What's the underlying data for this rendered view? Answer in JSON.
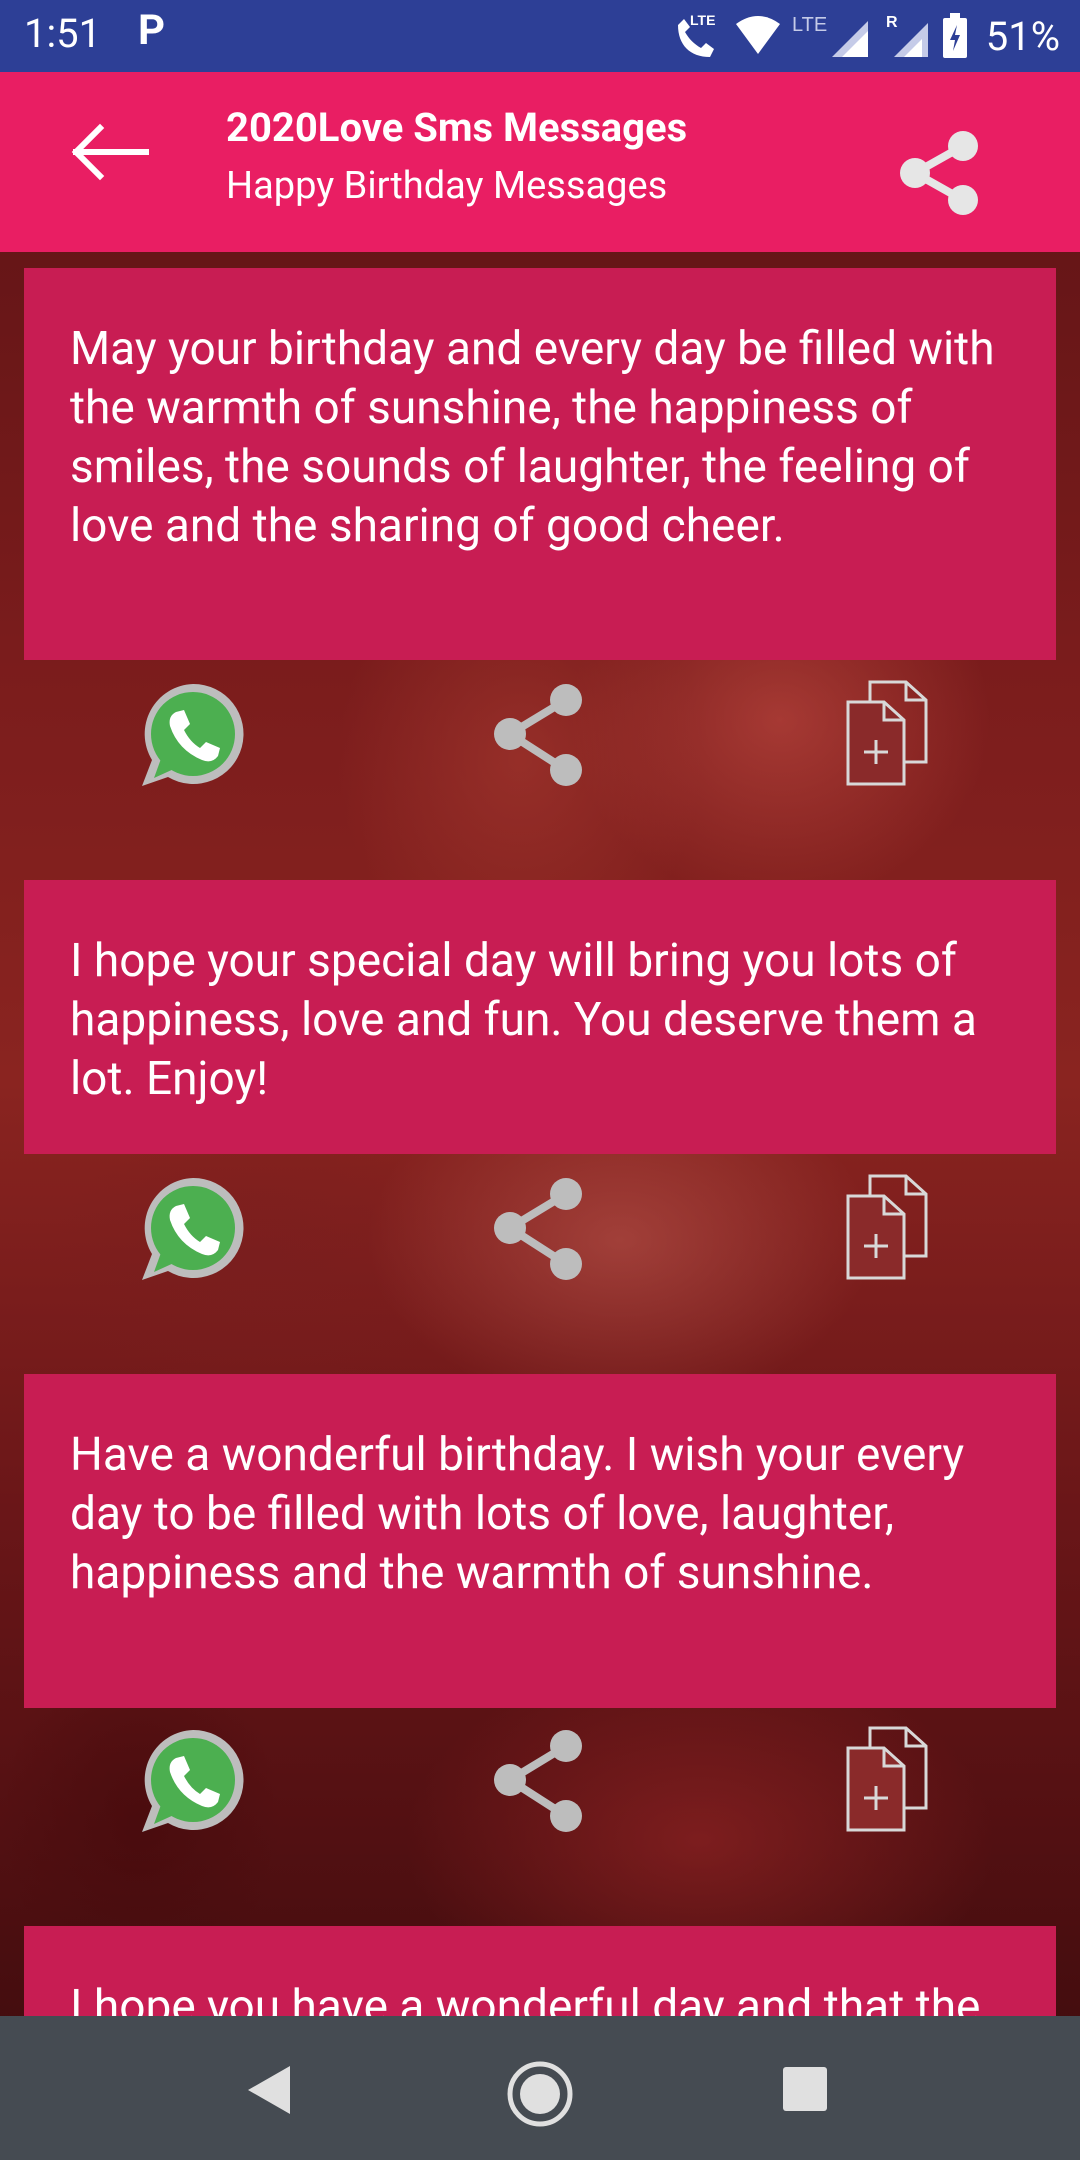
{
  "status_bar": {
    "time": "1:51",
    "notification_glyph": "P",
    "network_label_1": "LTE",
    "network_label_2": "LTE",
    "roaming_label": "R",
    "battery": "51%",
    "background": "#2d3f96"
  },
  "app_bar": {
    "title": "2020Love Sms Messages",
    "subtitle": "Happy Birthday Messages",
    "background": "#e91e63",
    "back_icon": "arrow-left",
    "share_icon": "share"
  },
  "messages": [
    {
      "text": "May your birthday and every day be filled with the warmth of sunshine, the happiness of smiles, the sounds of laughter, the feeling of love and the sharing of good cheer."
    },
    {
      "text": "I hope your special day will bring you lots of happiness, love and fun. You deserve them a lot. Enjoy!"
    },
    {
      "text": "Have a wonderful birthday. I wish your every day to be filled with lots of love, laughter, happiness and the warmth of sunshine."
    },
    {
      "text": "I hope you have a wonderful day and that the year ahead is filled with much love"
    }
  ],
  "card_color": "#c81d53",
  "action_icons": [
    "whatsapp-icon",
    "share-icon",
    "copy-icon"
  ],
  "nav_bar": {
    "background": "#454b52",
    "buttons": [
      "back",
      "home",
      "recents"
    ]
  }
}
